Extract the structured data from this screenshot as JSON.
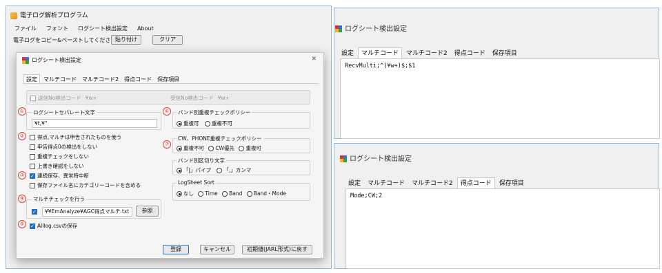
{
  "main_window": {
    "title": "電子ログ解析プログラム",
    "menu": [
      "ファイル",
      "フォント",
      "ログシート検出設定",
      "About"
    ],
    "paste_prompt": "電子ログをコピー&ペーストしてください",
    "paste_button": "貼り付け",
    "clear_button": "クリア"
  },
  "dialog": {
    "title": "ログシート検出設定",
    "close_glyph": "✕",
    "tabs": [
      "設定",
      "マルチコード",
      "マルチコード2",
      "得点コード",
      "保存項目"
    ],
    "send_no_label": "送信No検出コード",
    "send_no_value": "¥w+",
    "recv_no_label": "受信No検出コード",
    "recv_no_value": "¥w+",
    "separator_group": "ログシートセパレート文字",
    "separator_value": "¥t,¥\"",
    "checkboxes": [
      {
        "label": "得点,マルチは申告されたものを使う",
        "checked": false
      },
      {
        "label": "申告得点0の検出をしない",
        "checked": false
      },
      {
        "label": "重複チェックをしない",
        "checked": false
      },
      {
        "label": "上書き確認をしない",
        "checked": false
      },
      {
        "label": "連続保存、異常時中断",
        "checked": true
      },
      {
        "label": "保存ファイル名にカテゴリーコードを含める",
        "checked": false
      }
    ],
    "multi_check_group": "マルチチェックを行う",
    "multi_file_value": "¥¥EmAnalyze¥AGC得点マルチ.txt",
    "browse_button": "参照",
    "alllog_label": "Alllog.csvの保存",
    "band_dup_group": "バンド別重複チェックポリシー",
    "band_dup_options": [
      "重複可",
      "重複不可"
    ],
    "band_dup_selected": 0,
    "cw_phone_group": "CW、PHONE重複チェックポリシー",
    "cw_phone_options": [
      "重複不可",
      "CW優先",
      "重複可"
    ],
    "cw_phone_selected": 0,
    "band_sep_group": "バンド別区切り文字",
    "band_sep_options": [
      "「|」パイプ",
      "「,」カンマ"
    ],
    "band_sep_selected": 0,
    "sort_group": "LogSheet Sort",
    "sort_options": [
      "なし",
      "Time",
      "Band",
      "Band・Mode"
    ],
    "sort_selected": 0,
    "register_button": "登録",
    "cancel_button": "キャンセル",
    "reset_button": "初期値(JARL形式)に戻す"
  },
  "markers": [
    "①",
    "②",
    "③",
    "④",
    "⑤",
    "⑥",
    "⑦",
    "⑧",
    "⑨"
  ],
  "panel_top": {
    "title": "ログシート検出設定",
    "tabs": [
      "設定",
      "マルチコード",
      "マルチコード2",
      "得点コード",
      "保存項目"
    ],
    "selected_tab": 1,
    "content": "RecvMulti;^(¥w+)$;$1"
  },
  "panel_bottom": {
    "title": "ログシート検出設定",
    "tabs": [
      "設定",
      "マルチコード",
      "マルチコード2",
      "得点コード",
      "保存項目"
    ],
    "selected_tab": 3,
    "content": "Mode;CW;2"
  },
  "colors": {
    "accent": "#1f6fc4",
    "marker": "#d63a2f",
    "frame": "#90bcd8"
  }
}
